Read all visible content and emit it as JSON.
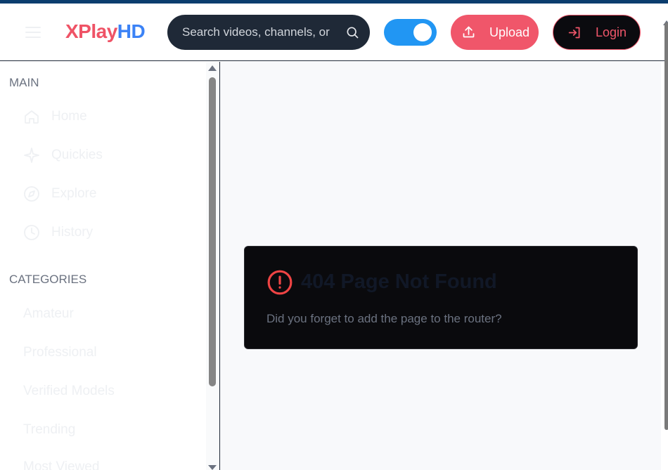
{
  "header": {
    "logo_part1": "XPlay",
    "logo_part2": "HD",
    "search_placeholder": "Search videos, channels, or",
    "theme_toggle_on": true,
    "upload_label": "Upload",
    "login_label": "Login"
  },
  "sidebar": {
    "main_title": "MAIN",
    "main_items": [
      {
        "label": "Home",
        "icon": "home-icon"
      },
      {
        "label": "Quickies",
        "icon": "sparkle-icon"
      },
      {
        "label": "Explore",
        "icon": "compass-icon"
      },
      {
        "label": "History",
        "icon": "clock-icon"
      }
    ],
    "categories_title": "CATEGORIES",
    "categories": [
      "Amateur",
      "Professional",
      "Verified Models",
      "Trending",
      "Most Viewed"
    ]
  },
  "error": {
    "title": "404 Page Not Found",
    "message": "Did you forget to add the page to the router?",
    "icon": "alert-circle-icon"
  },
  "colors": {
    "brand_red": "#ef5366",
    "brand_blue": "#3b82f6",
    "toggle_blue": "#2196f3",
    "error_red": "#ef4444"
  }
}
